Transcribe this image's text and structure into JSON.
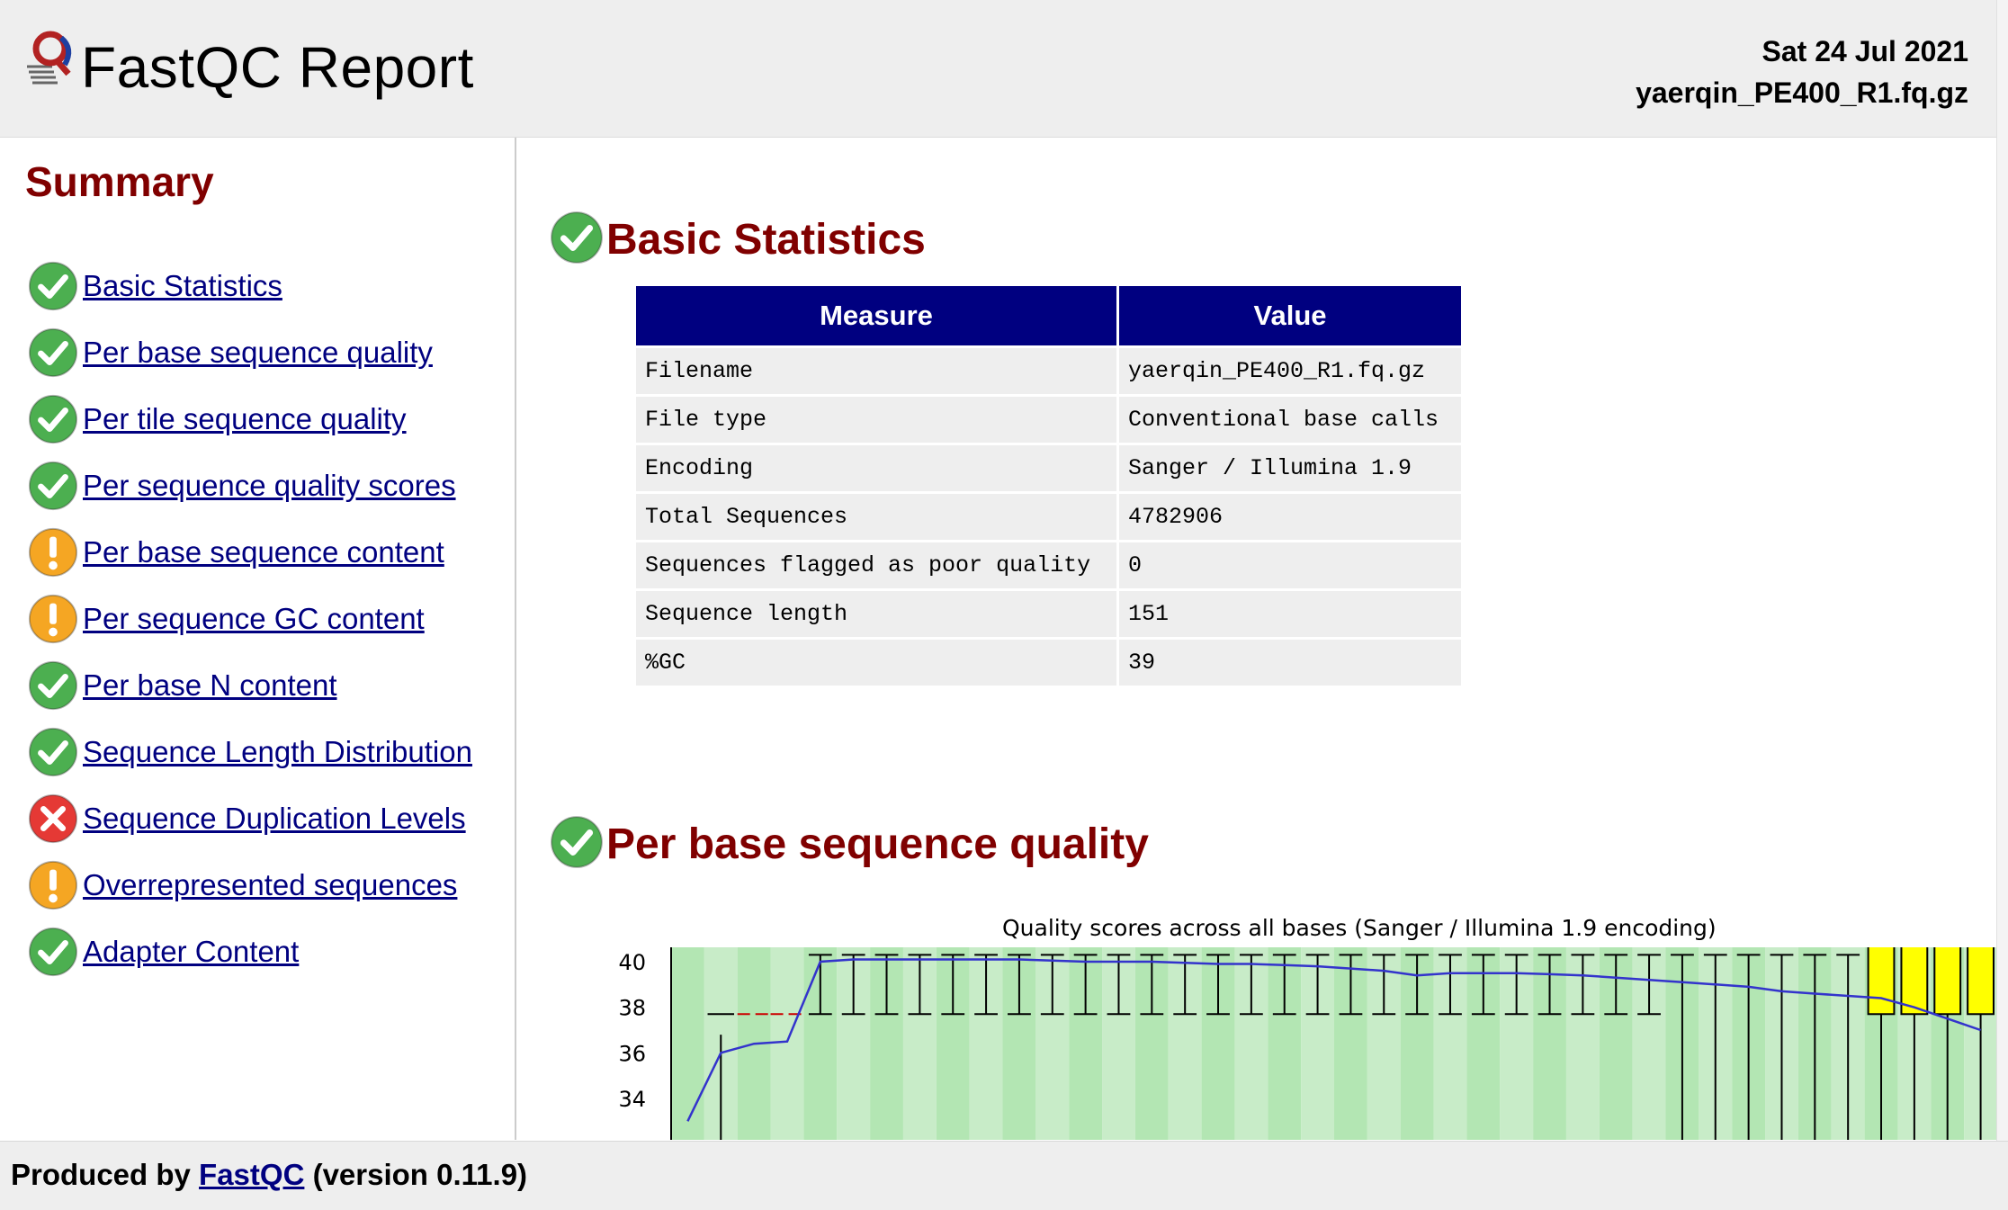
{
  "header": {
    "title": "FastQC Report",
    "date": "Sat 24 Jul 2021",
    "filename": "yaerqin_PE400_R1.fq.gz"
  },
  "sidebar": {
    "title": "Summary",
    "items": [
      {
        "label": "Basic Statistics",
        "status": "pass"
      },
      {
        "label": "Per base sequence quality",
        "status": "pass"
      },
      {
        "label": "Per tile sequence quality",
        "status": "pass"
      },
      {
        "label": "Per sequence quality scores",
        "status": "pass"
      },
      {
        "label": "Per base sequence content",
        "status": "warn"
      },
      {
        "label": "Per sequence GC content",
        "status": "warn"
      },
      {
        "label": "Per base N content",
        "status": "pass"
      },
      {
        "label": "Sequence Length Distribution",
        "status": "pass"
      },
      {
        "label": "Sequence Duplication Levels",
        "status": "fail"
      },
      {
        "label": "Overrepresented sequences",
        "status": "warn"
      },
      {
        "label": "Adapter Content",
        "status": "pass"
      }
    ]
  },
  "basic_statistics": {
    "title": "Basic Statistics",
    "status": "pass",
    "headers": {
      "measure": "Measure",
      "value": "Value"
    },
    "rows": [
      {
        "measure": "Filename",
        "value": "yaerqin_PE400_R1.fq.gz"
      },
      {
        "measure": "File type",
        "value": "Conventional base calls"
      },
      {
        "measure": "Encoding",
        "value": "Sanger / Illumina 1.9"
      },
      {
        "measure": "Total Sequences",
        "value": "4782906"
      },
      {
        "measure": "Sequences flagged as poor quality",
        "value": "0"
      },
      {
        "measure": "Sequence length",
        "value": "151"
      },
      {
        "measure": "%GC",
        "value": "39"
      }
    ]
  },
  "per_base_quality": {
    "title": "Per base sequence quality",
    "status": "pass",
    "chart_title": "Quality scores across all bases (Sanger / Illumina 1.9 encoding)"
  },
  "chart_data": {
    "type": "box",
    "title": "Quality scores across all bases (Sanger / Illumina 1.9 encoding)",
    "y_ticks": [
      40,
      38,
      36,
      34
    ],
    "ylim": [
      33,
      41
    ],
    "mean_line": [
      33,
      36,
      36.4,
      36.5,
      40,
      40.1,
      40.1,
      40.1,
      40.1,
      40.1,
      40.1,
      40.05,
      40,
      40,
      40,
      39.95,
      39.9,
      39.9,
      39.85,
      39.8,
      39.7,
      39.6,
      39.4,
      39.5,
      39.5,
      39.5,
      39.45,
      39.4,
      39.3,
      39.2,
      39.1,
      39.0,
      38.9,
      38.7,
      38.6,
      38.5,
      38.4,
      38.0,
      37.5,
      37
    ],
    "colors": {
      "pass": "#4caf50",
      "warn": "#f5a623",
      "fail": "#e53935",
      "heading": "#800000",
      "table_header": "#000080",
      "link": "#000080",
      "good_zone": "#b3e6b3",
      "box_fill": "#ffff00",
      "mean_line": "#3333cc",
      "median_line": "#cc0000"
    }
  },
  "footer": {
    "prefix": "Produced by ",
    "link": "FastQC",
    "suffix": " (version 0.11.9)"
  }
}
